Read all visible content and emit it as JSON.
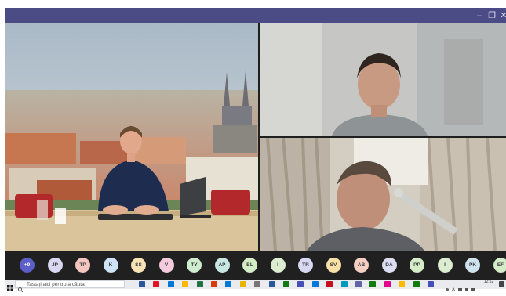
{
  "window": {
    "controls": {
      "minimize": "–",
      "maximize": "❐",
      "close": "✕"
    },
    "title_bar_color": "#4b4c86"
  },
  "video_tiles": [
    {
      "id": "presenter",
      "description_icon": "video-feed"
    },
    {
      "id": "participant-top-right",
      "description_icon": "video-feed"
    },
    {
      "id": "participant-bottom-right",
      "description_icon": "video-feed"
    }
  ],
  "participants": [
    {
      "initials": "+9",
      "color": "#5b5fc7",
      "text_color": "#ffffff"
    },
    {
      "initials": "JP",
      "color": "#d9d7f2"
    },
    {
      "initials": "TP",
      "color": "#f5c6c0"
    },
    {
      "initials": "K",
      "color": "#cde3f5"
    },
    {
      "initials": "SŠ",
      "color": "#f7e3b5"
    },
    {
      "initials": "V",
      "color": "#f3cbdc"
    },
    {
      "initials": "TY",
      "color": "#cfeccf"
    },
    {
      "initials": "AP",
      "color": "#c8e7e4"
    },
    {
      "initials": "BL",
      "color": "#d4edc7"
    },
    {
      "initials": "I",
      "color": "#dcedd0"
    },
    {
      "initials": "TR",
      "color": "#d8d8f2"
    },
    {
      "initials": "SV",
      "color": "#f6e2a6"
    },
    {
      "initials": "AB",
      "color": "#f5cfc4"
    },
    {
      "initials": "DA",
      "color": "#dcdcf3"
    },
    {
      "initials": "PP",
      "color": "#d5ecc8"
    },
    {
      "initials": "I",
      "color": "#dcedd0"
    },
    {
      "initials": "PK",
      "color": "#cfe3ee"
    },
    {
      "initials": "EF",
      "color": "#d5ecc8"
    }
  ],
  "taskbar": {
    "search_placeholder": "Tastați aici pentru a căuta",
    "clock_time": "12:52",
    "pinned_icon_colors": [
      "#2b579a",
      "#e81123",
      "#0078d7",
      "#ffb900",
      "#217346",
      "#d83b01",
      "#0078d7",
      "#e8b400",
      "#7a7574",
      "#2b579a",
      "#107c10",
      "#464eb8",
      "#0078d7",
      "#c50f1f",
      "#0099bc",
      "#6264a7",
      "#107c10",
      "#e3008c",
      "#ffb900",
      "#107c10",
      "#464eb8"
    ]
  }
}
